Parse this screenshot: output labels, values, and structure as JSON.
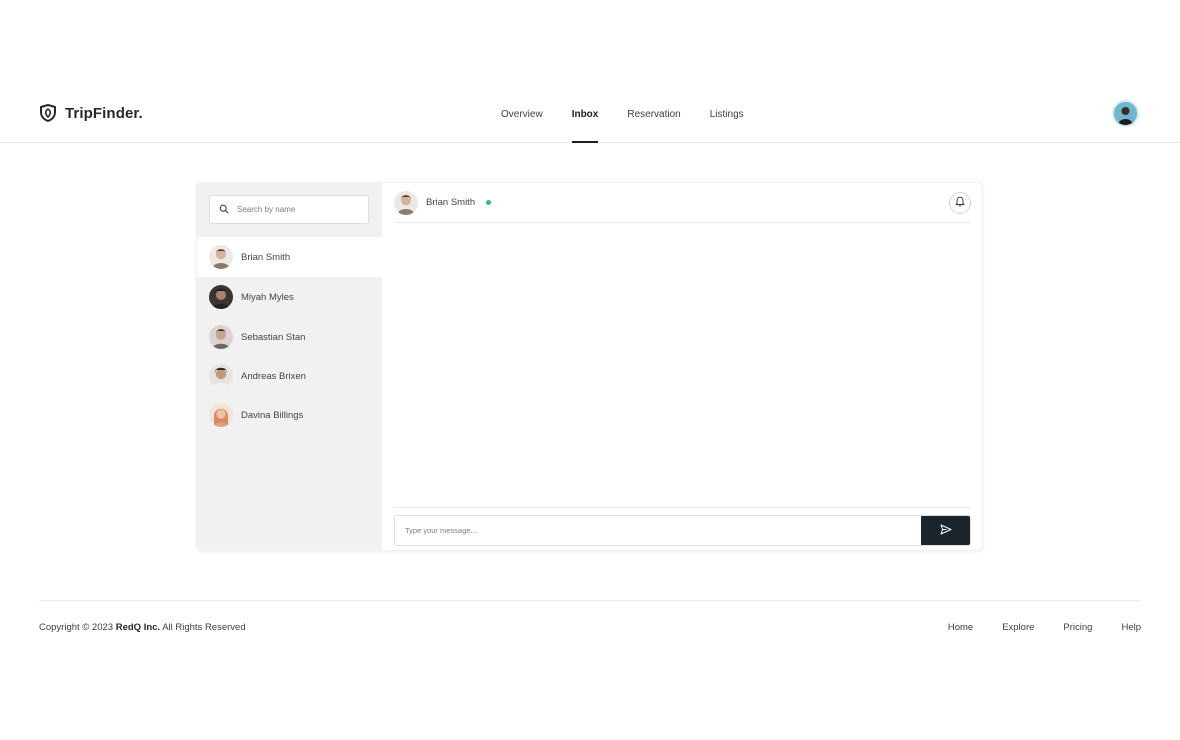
{
  "brand": {
    "name": "TripFinder.",
    "icon": "shield-leaf-icon"
  },
  "nav": {
    "items": [
      {
        "label": "Overview",
        "active": false
      },
      {
        "label": "Inbox",
        "active": true
      },
      {
        "label": "Reservation",
        "active": false
      },
      {
        "label": "Listings",
        "active": false
      }
    ]
  },
  "inbox": {
    "search": {
      "placeholder": "Search by name",
      "value": ""
    },
    "contacts": [
      {
        "name": "Brian Smith",
        "active": true,
        "avatar_color": "#c9b8a6"
      },
      {
        "name": "Miyah Myles",
        "active": false,
        "avatar_color": "#3b3634"
      },
      {
        "name": "Sebastian Stan",
        "active": false,
        "avatar_color": "#b4aaa2"
      },
      {
        "name": "Andreas Brixen",
        "active": false,
        "avatar_color": "#5a4a3e"
      },
      {
        "name": "Davina Billings",
        "active": false,
        "avatar_color": "#e0a084"
      }
    ]
  },
  "chat": {
    "contact_name": "Brian Smith",
    "status": "online",
    "status_color": "#27c37a",
    "composer": {
      "placeholder": "Type your message...",
      "value": ""
    }
  },
  "footer": {
    "copyright_prefix": "Copyright © 2023",
    "company": "RedQ Inc.",
    "copyright_suffix": "All Rights Reserved",
    "links": [
      "Home",
      "Explore",
      "Pricing",
      "Help"
    ]
  },
  "colors": {
    "accent_dark": "#1b232b",
    "sidebar_bg": "#f1f1f1",
    "online": "#27c37a"
  }
}
